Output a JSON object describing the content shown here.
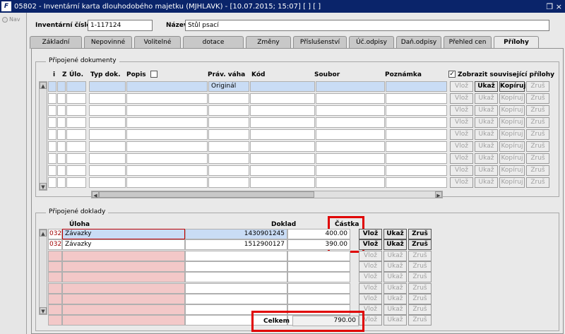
{
  "window": {
    "title": "05802 - Inventární karta dlouhodobého majetku (MJHLAVK) - [10.07.2015; 15:07]  [ ]  [ ]",
    "app_icon": "F",
    "restore_glyph": "❐ ×"
  },
  "nav": {
    "label": "Nav"
  },
  "header": {
    "inv_label": "Inventární číslo",
    "inv_value": "1-117124",
    "name_label": "Název",
    "name_value": "Stůl psací"
  },
  "tabs": [
    "Základní",
    "Nepovinné",
    "Volitelné",
    "dotace",
    "Změny",
    "Příslušenství",
    "Úč.odpisy",
    "Daň.odpisy",
    "Přehled cen",
    "Přílohy"
  ],
  "active_tab": "Přílohy",
  "docs": {
    "group_title": "Připojené dokumenty",
    "columns": {
      "i": "i",
      "z": "Z",
      "ulo": "Úlo.",
      "typ": "Typ dok.",
      "popis": "Popis",
      "prav": "Práv. váha",
      "kod": "Kód",
      "soubor": "Soubor",
      "poznamka": "Poznámka"
    },
    "show_related_label": "Zobrazit související přílohy",
    "show_related_checked": true,
    "rows": [
      {
        "prav": "Originál"
      },
      {
        "prav": ""
      },
      {
        "prav": ""
      },
      {
        "prav": ""
      },
      {
        "prav": ""
      },
      {
        "prav": ""
      },
      {
        "prav": ""
      },
      {
        "prav": ""
      },
      {
        "prav": ""
      }
    ],
    "buttons": {
      "vloz": "Vlož",
      "ukaz": "Ukaž",
      "kopiruj": "Kopíruj",
      "zrus": "Zruš"
    }
  },
  "attached": {
    "group_title": "Připojené doklady",
    "columns": {
      "uloha": "Úloha",
      "doklad": "Doklad",
      "castka": "Částka"
    },
    "rows": [
      {
        "code": "032",
        "uloha": "Závazky",
        "doklad": "1430901245",
        "castka": "400.00"
      },
      {
        "code": "032",
        "uloha": "Závazky",
        "doklad": "1512900127",
        "castka": "390.00"
      },
      {
        "code": "",
        "uloha": "",
        "doklad": "",
        "castka": ""
      },
      {
        "code": "",
        "uloha": "",
        "doklad": "",
        "castka": ""
      },
      {
        "code": "",
        "uloha": "",
        "doklad": "",
        "castka": ""
      },
      {
        "code": "",
        "uloha": "",
        "doklad": "",
        "castka": ""
      },
      {
        "code": "",
        "uloha": "",
        "doklad": "",
        "castka": ""
      },
      {
        "code": "",
        "uloha": "",
        "doklad": "",
        "castka": ""
      },
      {
        "code": "",
        "uloha": "",
        "doklad": "",
        "castka": ""
      }
    ],
    "buttons": {
      "vloz": "Vlož",
      "ukaz": "Ukaž",
      "zrus": "Zruš"
    },
    "total_label": "Celkem",
    "total_value": "790.00"
  },
  "colors": {
    "titlebar": "#0a246a",
    "highlight": "#e00000",
    "selected_row": "#c9dcf5",
    "pink_cell": "#f3c8c8"
  }
}
